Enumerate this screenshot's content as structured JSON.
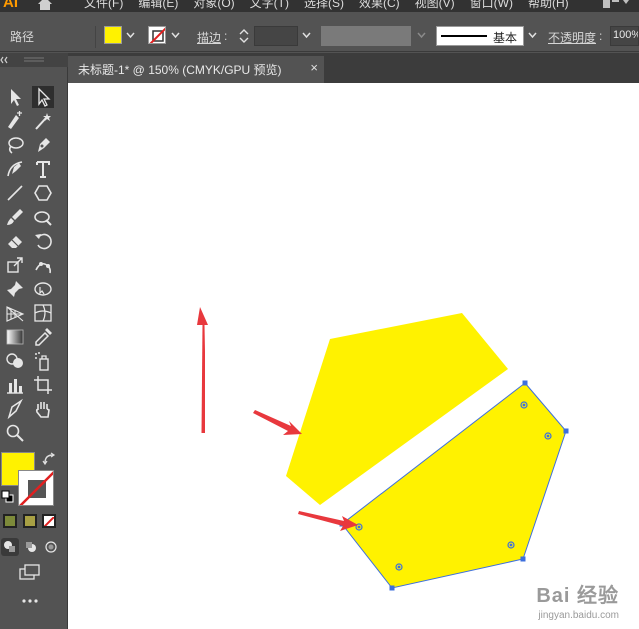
{
  "app": {
    "logo": "AI"
  },
  "menu": [
    "文件(F)",
    "编辑(E)",
    "对象(O)",
    "文字(T)",
    "选择(S)",
    "效果(C)",
    "视图(V)",
    "窗口(W)",
    "帮助(H)"
  ],
  "control_bar": {
    "object_type": "路径",
    "stroke_label": "描边",
    "stroke_colon": ":",
    "brush_label": "基本",
    "opacity_label": "不透明度",
    "opacity_colon": ":",
    "opacity_value": "100%"
  },
  "document_tab": {
    "title": "未标题-1* @ 150% (CMYK/GPU 预览)",
    "close": "×"
  },
  "colors": {
    "fill": "#fff200",
    "shape_fill": "#fff200",
    "selection": "#3d6fdd",
    "arrow": "#e8383d",
    "accent_orange": "#ff9a00"
  },
  "tools": [
    "selection-tool",
    "direct-selection-tool",
    "group-selection-tool",
    "magic-wand-tool",
    "lasso-tool",
    "pen-tool",
    "curvature-tool",
    "type-tool",
    "line-tool",
    "polygon-tool",
    "paintbrush-tool",
    "blob-brush-tool",
    "eraser-tool",
    "rotate-tool",
    "scale-tool",
    "puppet-warp-tool",
    "pin-tool",
    "free-transform-tool",
    "perspective-grid-tool",
    "mesh-tool",
    "gradient-tool",
    "eyedropper-tool",
    "symbol-sprayer-tool",
    "blend-tool",
    "column-graph-tool",
    "artboard-tool",
    "slice-tool",
    "hand-tool",
    "zoom-tool"
  ],
  "watermark": {
    "line1": "Bai 经验",
    "line2": "jingyan.baidu.com"
  }
}
